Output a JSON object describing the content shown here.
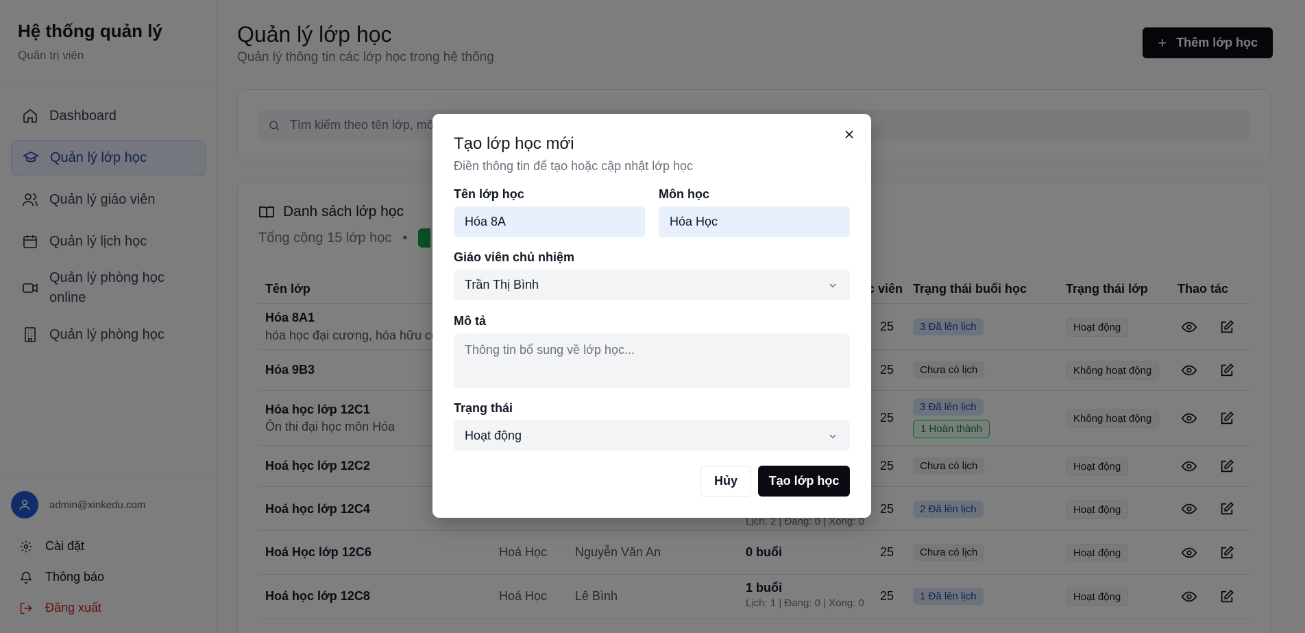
{
  "sidebar": {
    "title": "Hệ thống quản lý",
    "subtitle": "Quản trị viên",
    "items": [
      {
        "label": "Dashboard",
        "icon": "home-icon"
      },
      {
        "label": "Quản lý lớp học",
        "icon": "graduation-cap-icon"
      },
      {
        "label": "Quản lý giáo viên",
        "icon": "users-icon"
      },
      {
        "label": "Quản lý lịch học",
        "icon": "calendar-icon"
      },
      {
        "label": "Quản lý phòng học online",
        "icon": "video-icon"
      },
      {
        "label": "Quản lý phòng học",
        "icon": "building-icon"
      }
    ],
    "user_email": "admin@xinkedu.com",
    "settings_label": "Cài đặt",
    "notifications_label": "Thông báo",
    "logout_label": "Đăng xuất"
  },
  "header": {
    "title": "Quản lý lớp học",
    "subtitle": "Quản lý thông tin các lớp học trong hệ thống",
    "add_button": "Thêm lớp học"
  },
  "search": {
    "placeholder": "Tìm kiếm theo tên lớp, mô"
  },
  "list": {
    "title": "Danh sách lớp học",
    "summary": "Tổng cộng 15 lớp học",
    "columns": [
      "Tên lớp",
      "",
      "",
      "",
      "c viên",
      "Trạng thái buổi học",
      "Trạng thái lớp",
      "Thao tác"
    ],
    "rows": [
      {
        "name": "Hóa 8A1",
        "desc": "hóa học đại cương, hóa hữu cơ",
        "subject": "",
        "teacher": "",
        "sessions": "",
        "meta": "",
        "students": "25",
        "session_badges": [
          "3 Đã lên lịch"
        ],
        "status": "Hoạt động"
      },
      {
        "name": "Hóa 9B3",
        "desc": "",
        "subject": "",
        "teacher": "",
        "sessions": "",
        "meta": "",
        "students": "25",
        "session_badges": [
          "Chưa có lịch"
        ],
        "status": "Không hoạt động"
      },
      {
        "name": "Hóa học lớp 12C1",
        "desc": "Ôn thi đại học môn Hóa",
        "subject": "",
        "teacher": "",
        "sessions": "",
        "meta": "",
        "students": "25",
        "session_badges": [
          "3 Đã lên lịch",
          "1 Hoàn thành"
        ],
        "status": "Không hoạt động"
      },
      {
        "name": "Hoá học lớp 12C2",
        "desc": "",
        "subject": "",
        "teacher": "",
        "sessions": "",
        "meta": "",
        "students": "25",
        "session_badges": [
          "Chưa có lịch"
        ],
        "status": "Hoạt động"
      },
      {
        "name": "Hoá học lớp 12C4",
        "desc": "",
        "subject": "",
        "teacher": "",
        "sessions": "",
        "meta": "Lịch: 2 | Đang: 0 | Xong: 0",
        "students": "25",
        "session_badges": [
          "2 Đã lên lịch"
        ],
        "status": "Hoạt động"
      },
      {
        "name": "Hoá Học lớp 12C6",
        "desc": "",
        "subject": "Hoá Học",
        "teacher": "Nguyễn Văn An",
        "sessions": "0 buổi",
        "meta": "",
        "students": "25",
        "session_badges": [
          "Chưa có lịch"
        ],
        "status": "Hoạt động"
      },
      {
        "name": "Hoá học lớp 12C8",
        "desc": "",
        "subject": "Hoá Học",
        "teacher": "Lê Bình",
        "sessions": "1 buổi",
        "meta": "Lịch: 1 | Đang: 0 | Xong: 0",
        "students": "25",
        "session_badges": [
          "1 Đã lên lịch"
        ],
        "status": "Hoạt động"
      }
    ]
  },
  "modal": {
    "title": "Tạo lớp học mới",
    "subtitle": "Điền thông tin để tạo hoặc cập nhật lớp học",
    "class_name_label": "Tên lớp học",
    "class_name_value": "Hóa 8A",
    "subject_label": "Môn học",
    "subject_value": "Hóa Học",
    "teacher_label": "Giáo viên chủ nhiệm",
    "teacher_value": "Trần Thị Bình",
    "description_label": "Mô tả",
    "description_placeholder": "Thông tin bổ sung về lớp học...",
    "status_label": "Trạng thái",
    "status_value": "Hoạt động",
    "cancel_button": "Hủy",
    "submit_button": "Tạo lớp học"
  },
  "colors": {
    "primary_dark": "#0b0b14",
    "active_blue": "#2446a8",
    "logout_red": "#c81e1e",
    "success_green": "#16a34a"
  }
}
